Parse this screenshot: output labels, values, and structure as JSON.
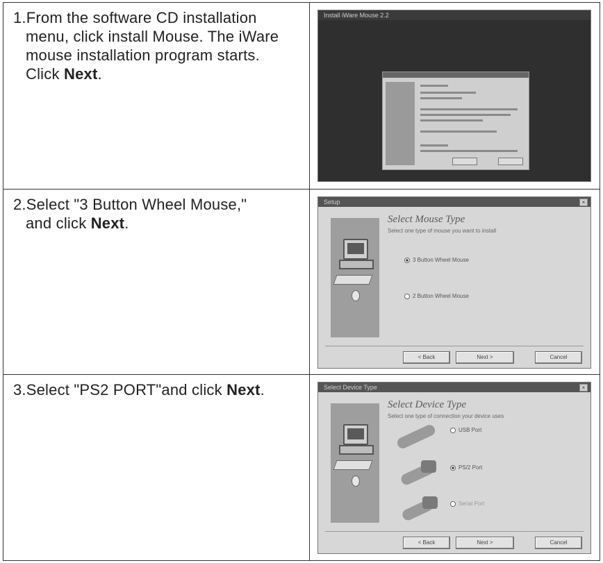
{
  "steps": [
    {
      "lines": [
        "1.From the software CD installation",
        "menu, click install Mouse. The iWare",
        "mouse installation program  starts."
      ],
      "last_prefix": "Click ",
      "bold_word": "Next",
      "last_suffix": ".",
      "screenshot": {
        "window_title": "Install iWare Mouse 2.2",
        "description_icon": "installer-dialog-image"
      }
    },
    {
      "lines": [
        "2.Select \"3 Button Wheel Mouse,\""
      ],
      "last_prefix": "and click ",
      "bold_word": "Next",
      "last_suffix": ".",
      "screenshot": {
        "window_title": "Setup",
        "heading": "Select Mouse Type",
        "subtitle": "Select one type of mouse you want to install",
        "options": [
          "3 Button Wheel Mouse",
          "2 Button Wheel Mouse"
        ],
        "selected_index": 0,
        "buttons": [
          "< Back",
          "Next >",
          "Cancel"
        ]
      }
    },
    {
      "lines": [],
      "last_prefix": "3.Select \"PS2 PORT\"and click ",
      "bold_word": "Next",
      "last_suffix": ".",
      "screenshot": {
        "window_title": "Select Device Type",
        "heading": "Select Device Type",
        "subtitle": "Select one type of connection your device uses",
        "options": [
          "USB Port",
          "PS/2 Port",
          "Serial Port"
        ],
        "selected_index": 1,
        "buttons": [
          "< Back",
          "Next >",
          "Cancel"
        ]
      }
    }
  ]
}
